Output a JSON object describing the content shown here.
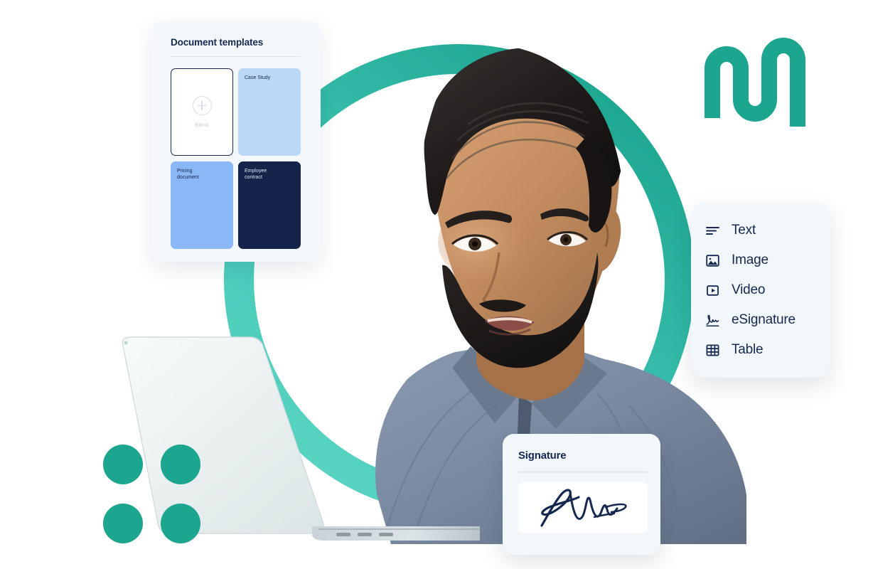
{
  "templates_panel": {
    "title": "Document templates",
    "cards": [
      {
        "label": "Blank",
        "kind": "blank",
        "accent": "#FFFFFF"
      },
      {
        "label": "Case Study",
        "kind": "case",
        "accent": "#BBD8F7"
      },
      {
        "label": "Pricing\ndocument",
        "kind": "pricing",
        "accent": "#8AB7F5"
      },
      {
        "label": "Employee\ncontract",
        "kind": "employee",
        "accent": "#15244B"
      }
    ]
  },
  "blocks_menu": {
    "items": [
      {
        "label": "Text",
        "icon": "text-lines-icon"
      },
      {
        "label": "Image",
        "icon": "image-icon"
      },
      {
        "label": "Video",
        "icon": "video-icon"
      },
      {
        "label": "eSignature",
        "icon": "esignature-icon"
      },
      {
        "label": "Table",
        "icon": "table-icon"
      }
    ]
  },
  "signature_panel": {
    "title": "Signature",
    "signature_alt": "handwritten-signature"
  },
  "decor": {
    "logo_alt": "wavy-squiggle-logo",
    "ring_alt": "teal-circle-ring",
    "dots_alt": "teal-dot-grid",
    "photo_alt": "man-smiling-at-laptop",
    "laptop_alt": "open-laptop"
  },
  "colors": {
    "teal": "#1CA58F",
    "teal_light": "#4ECFC0",
    "navy": "#16284F",
    "panel_bg": "#F2F7FB",
    "blue_light": "#BBD8F7",
    "blue_mid": "#8AB7F5"
  }
}
